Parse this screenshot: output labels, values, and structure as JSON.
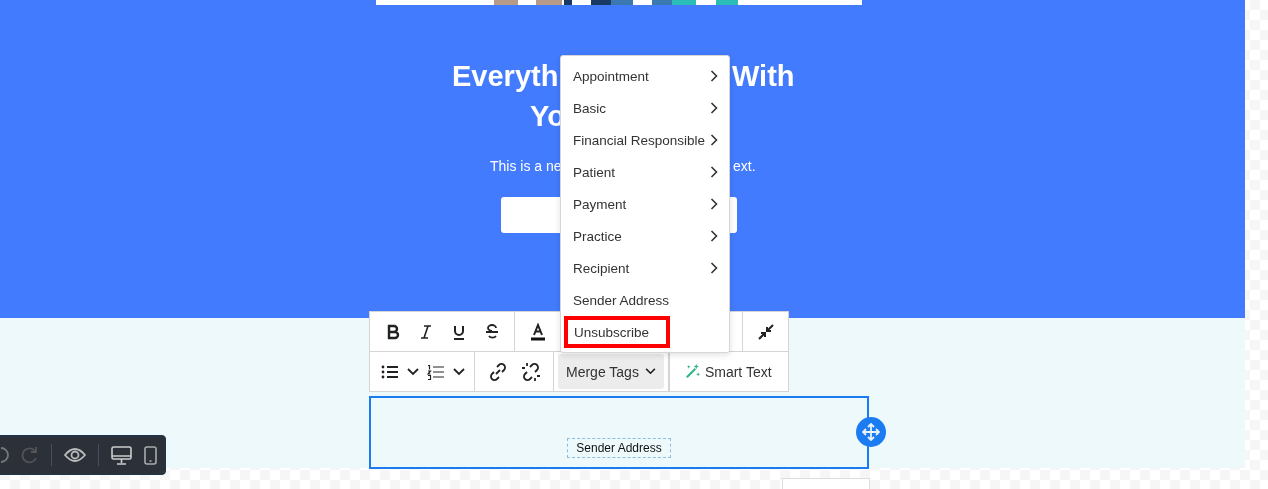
{
  "hero": {
    "heading_parts": [
      "Everyth",
      "With",
      "Yo"
    ],
    "subtitle_parts": [
      "This is a ne",
      "ext."
    ]
  },
  "merge_menu": {
    "items": [
      {
        "label": "Appointment",
        "has_submenu": true,
        "selected": false
      },
      {
        "label": "Basic",
        "has_submenu": true,
        "selected": false
      },
      {
        "label": "Financial Responsible",
        "has_submenu": true,
        "selected": false
      },
      {
        "label": "Patient",
        "has_submenu": true,
        "selected": false
      },
      {
        "label": "Payment",
        "has_submenu": true,
        "selected": false
      },
      {
        "label": "Practice",
        "has_submenu": true,
        "selected": false
      },
      {
        "label": "Recipient",
        "has_submenu": true,
        "selected": false
      },
      {
        "label": "Sender Address",
        "has_submenu": false,
        "selected": false
      },
      {
        "label": "Unsubscribe",
        "has_submenu": false,
        "selected": true
      }
    ]
  },
  "toolbar": {
    "merge_tags": {
      "label": "Merge Tags",
      "selected": true
    },
    "smart_text": {
      "label": "Smart Text"
    }
  },
  "text_block": {
    "merge_tag": "Sender Address"
  }
}
